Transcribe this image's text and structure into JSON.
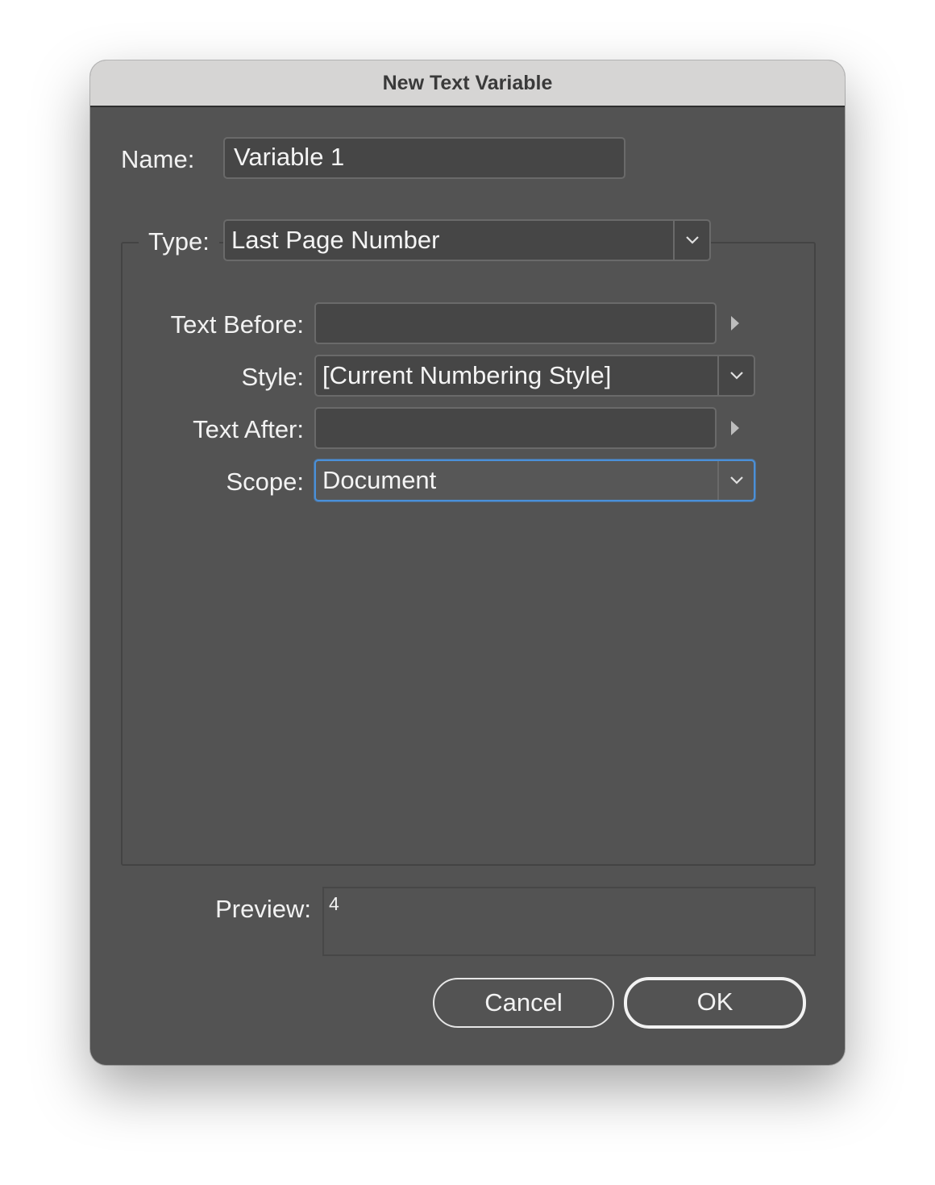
{
  "dialog": {
    "title": "New Text Variable"
  },
  "name": {
    "label": "Name:",
    "value": "Variable 1"
  },
  "type": {
    "label": "Type:",
    "value": "Last Page Number"
  },
  "text_before": {
    "label": "Text Before:",
    "value": ""
  },
  "style": {
    "label": "Style:",
    "value": "[Current Numbering Style]"
  },
  "text_after": {
    "label": "Text After:",
    "value": ""
  },
  "scope": {
    "label": "Scope:",
    "value": "Document"
  },
  "preview": {
    "label": "Preview:",
    "value": "4"
  },
  "buttons": {
    "cancel": "Cancel",
    "ok": "OK"
  },
  "colors": {
    "dialog_bg": "#535353",
    "titlebar_bg": "#d6d5d4",
    "field_bg": "#464646",
    "focus_ring": "#4a90d9"
  },
  "icons": {
    "dropdown": "chevron-down-icon",
    "insert_menu": "triangle-right-icon"
  }
}
